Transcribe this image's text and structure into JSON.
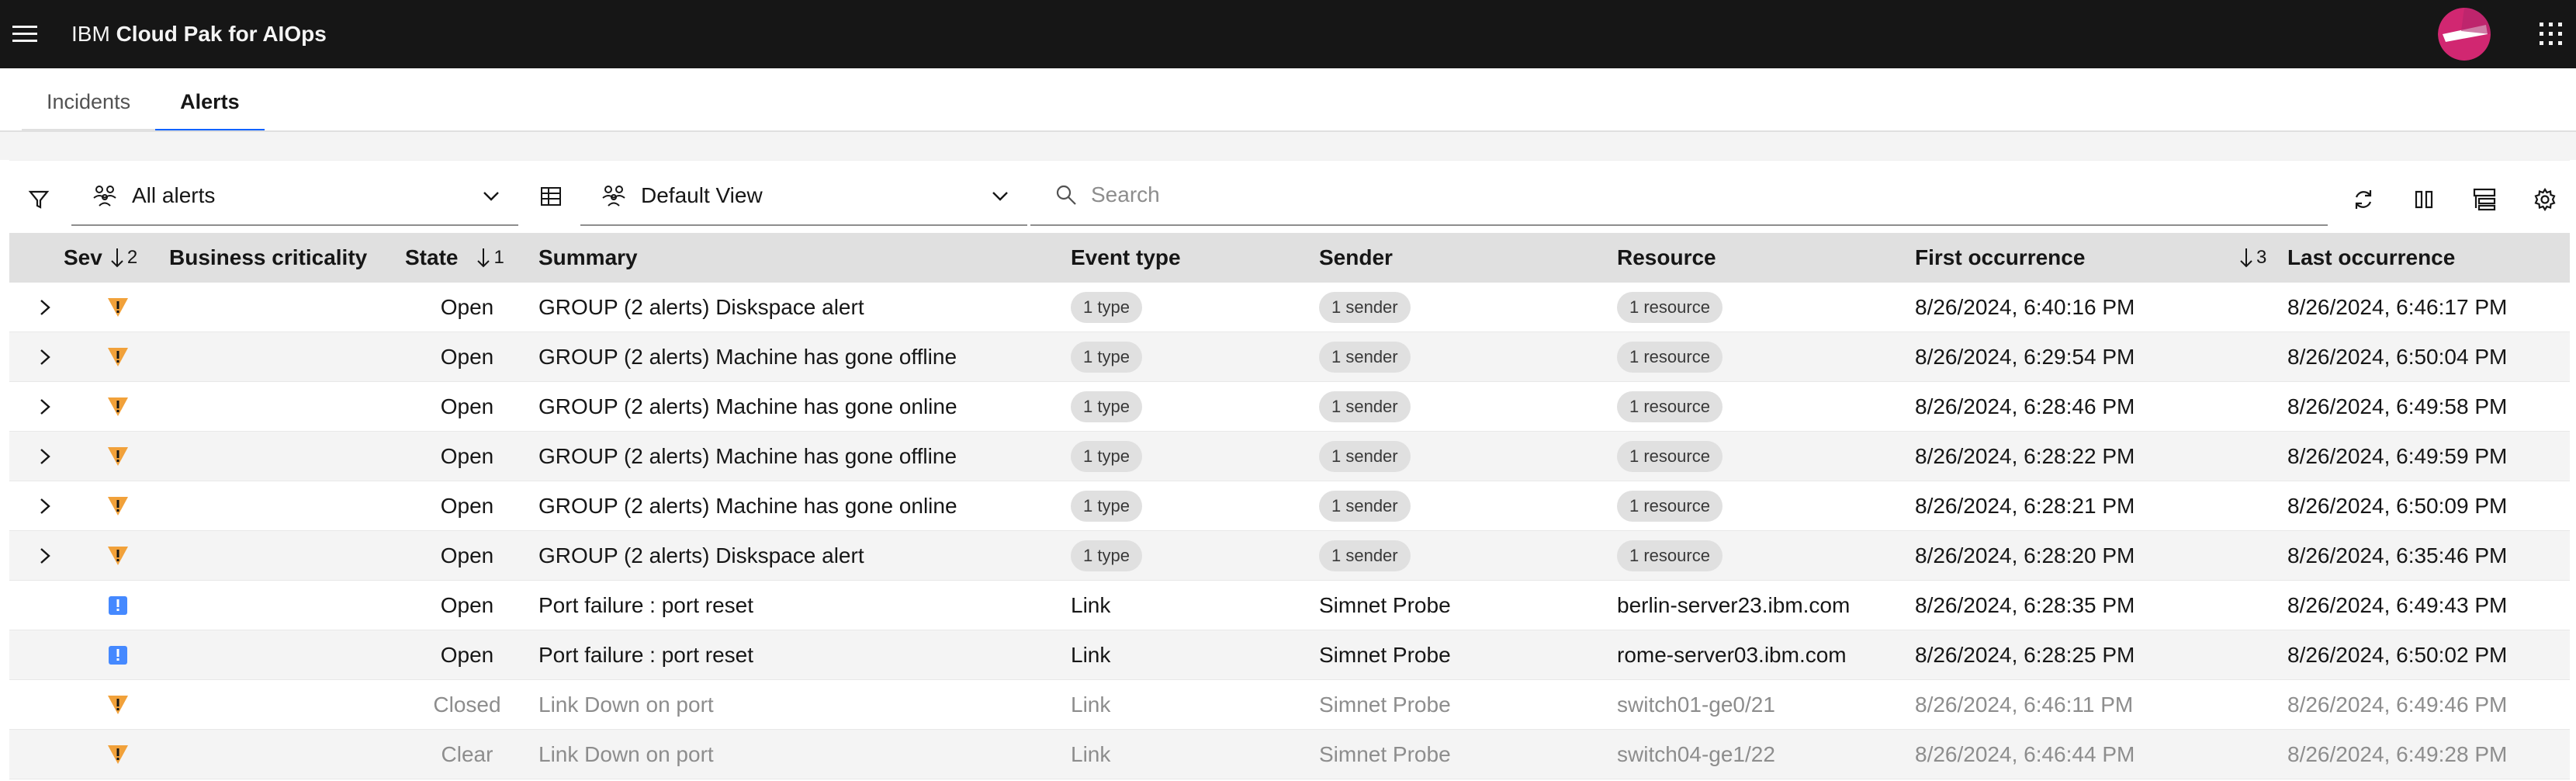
{
  "header": {
    "brand_prefix": "IBM",
    "brand_name": "Cloud Pak for AIOps",
    "icons": {
      "menu": "hamburger-menu-icon",
      "avatar": "user-avatar",
      "switcher": "app-switcher-icon"
    }
  },
  "tabs": [
    {
      "label": "Incidents",
      "active": false
    },
    {
      "label": "Alerts",
      "active": true
    }
  ],
  "toolbar": {
    "filter_icon": "filter-icon",
    "alerts_filter": {
      "label": "All alerts",
      "icon": "user-group-icon"
    },
    "table_icon": "table-icon",
    "view_select": {
      "label": "Default View",
      "icon": "user-group-icon"
    },
    "search": {
      "placeholder": "Search",
      "value": ""
    },
    "right_icons": [
      "refresh-icon",
      "column-icon",
      "group-by-icon",
      "settings-icon"
    ]
  },
  "table": {
    "columns": {
      "sev": "Sev",
      "sev_sort": "2",
      "business": "Business criticality",
      "state": "State",
      "state_sort": "1",
      "summary": "Summary",
      "event_type": "Event type",
      "sender": "Sender",
      "resource": "Resource",
      "first": "First occurrence",
      "first_sort": "3",
      "last": "Last occurrence"
    },
    "colors": {
      "major": "#f1a13a",
      "indeterminate": "#4589ff"
    },
    "rows": [
      {
        "expandable": true,
        "sev": "major",
        "state": "Open",
        "summary": "GROUP (2 alerts) Diskspace alert",
        "event_type": "1 type",
        "sender": "1 sender",
        "resource": "1 resource",
        "first": "8/26/2024, 6:40:16 PM",
        "last": "8/26/2024, 6:46:17 PM",
        "muted": false
      },
      {
        "expandable": true,
        "sev": "major",
        "state": "Open",
        "summary": "GROUP (2 alerts) Machine has gone offline",
        "event_type": "1 type",
        "sender": "1 sender",
        "resource": "1 resource",
        "first": "8/26/2024, 6:29:54 PM",
        "last": "8/26/2024, 6:50:04 PM",
        "muted": false
      },
      {
        "expandable": true,
        "sev": "major",
        "state": "Open",
        "summary": "GROUP (2 alerts) Machine has gone online",
        "event_type": "1 type",
        "sender": "1 sender",
        "resource": "1 resource",
        "first": "8/26/2024, 6:28:46 PM",
        "last": "8/26/2024, 6:49:58 PM",
        "muted": false
      },
      {
        "expandable": true,
        "sev": "major",
        "state": "Open",
        "summary": "GROUP (2 alerts) Machine has gone offline",
        "event_type": "1 type",
        "sender": "1 sender",
        "resource": "1 resource",
        "first": "8/26/2024, 6:28:22 PM",
        "last": "8/26/2024, 6:49:59 PM",
        "muted": false
      },
      {
        "expandable": true,
        "sev": "major",
        "state": "Open",
        "summary": "GROUP (2 alerts) Machine has gone online",
        "event_type": "1 type",
        "sender": "1 sender",
        "resource": "1 resource",
        "first": "8/26/2024, 6:28:21 PM",
        "last": "8/26/2024, 6:50:09 PM",
        "muted": false
      },
      {
        "expandable": true,
        "sev": "major",
        "state": "Open",
        "summary": "GROUP (2 alerts) Diskspace alert",
        "event_type": "1 type",
        "sender": "1 sender",
        "resource": "1 resource",
        "first": "8/26/2024, 6:28:20 PM",
        "last": "8/26/2024, 6:35:46 PM",
        "muted": false
      },
      {
        "expandable": false,
        "sev": "indeterminate",
        "state": "Open",
        "summary": "Port failure : port reset",
        "event_type": "Link",
        "sender": "Simnet Probe",
        "resource": "berlin-server23.ibm.com",
        "first": "8/26/2024, 6:28:35 PM",
        "last": "8/26/2024, 6:49:43 PM",
        "muted": false
      },
      {
        "expandable": false,
        "sev": "indeterminate",
        "state": "Open",
        "summary": "Port failure : port reset",
        "event_type": "Link",
        "sender": "Simnet Probe",
        "resource": "rome-server03.ibm.com",
        "first": "8/26/2024, 6:28:25 PM",
        "last": "8/26/2024, 6:50:02 PM",
        "muted": false
      },
      {
        "expandable": false,
        "sev": "major",
        "state": "Closed",
        "summary": "Link Down on port",
        "event_type": "Link",
        "sender": "Simnet Probe",
        "resource": "switch01-ge0/21",
        "first": "8/26/2024, 6:46:11 PM",
        "last": "8/26/2024, 6:49:46 PM",
        "muted": true
      },
      {
        "expandable": false,
        "sev": "major",
        "state": "Clear",
        "summary": "Link Down on port",
        "event_type": "Link",
        "sender": "Simnet Probe",
        "resource": "switch04-ge1/22",
        "first": "8/26/2024, 6:46:44 PM",
        "last": "8/26/2024, 6:49:28 PM",
        "muted": true
      }
    ]
  }
}
